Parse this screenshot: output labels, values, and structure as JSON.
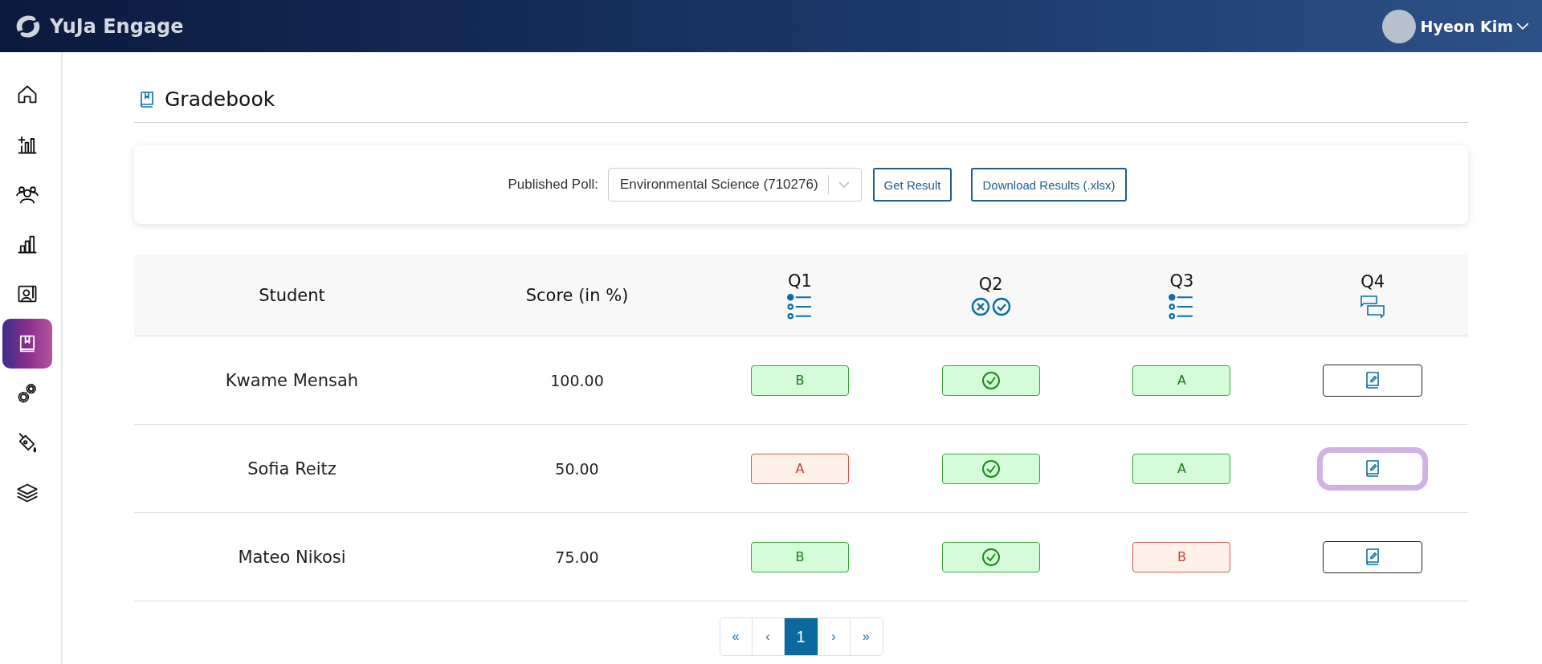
{
  "header": {
    "brand": "YuJa Engage",
    "user": "Hyeon Kim"
  },
  "sidebar": {
    "items": [
      {
        "kind": "home",
        "selected": false
      },
      {
        "kind": "create-chart",
        "selected": false
      },
      {
        "kind": "people",
        "selected": false
      },
      {
        "kind": "chart",
        "selected": false
      },
      {
        "kind": "presenter",
        "selected": false
      },
      {
        "kind": "gradebook",
        "selected": true
      },
      {
        "kind": "gears",
        "selected": false
      },
      {
        "kind": "paint",
        "selected": false
      },
      {
        "kind": "layers",
        "selected": false
      }
    ]
  },
  "page": {
    "title": "Gradebook"
  },
  "filter": {
    "label": "Published Poll:",
    "poll_value": "Environmental Science (710276)",
    "buttons": [
      "Get Result",
      "Download Results (.xlsx)"
    ]
  },
  "table": {
    "columns": [
      {
        "label": "Student"
      },
      {
        "label": "Score (in %)"
      },
      {
        "label": "Q1",
        "kind": "multiple-choice"
      },
      {
        "label": "Q2",
        "kind": "true-false"
      },
      {
        "label": "Q3",
        "kind": "multiple-choice"
      },
      {
        "label": "Q4",
        "kind": "open-ended"
      }
    ],
    "rows": [
      {
        "student": "Kwame Mensah",
        "score": "100.00",
        "answers": [
          {
            "kind": "choice",
            "text": "B",
            "correct": true
          },
          {
            "kind": "truefalse",
            "correct": true
          },
          {
            "kind": "choice",
            "text": "A",
            "correct": true
          },
          {
            "kind": "open",
            "focused": false
          }
        ]
      },
      {
        "student": "Sofia Reitz",
        "score": "50.00",
        "answers": [
          {
            "kind": "choice",
            "text": "A",
            "correct": false
          },
          {
            "kind": "truefalse",
            "correct": true
          },
          {
            "kind": "choice",
            "text": "A",
            "correct": true
          },
          {
            "kind": "open",
            "focused": true
          }
        ]
      },
      {
        "student": "Mateo Nikosi",
        "score": "75.00",
        "answers": [
          {
            "kind": "choice",
            "text": "B",
            "correct": true
          },
          {
            "kind": "truefalse",
            "correct": true
          },
          {
            "kind": "choice",
            "text": "B",
            "correct": false
          },
          {
            "kind": "open",
            "focused": false
          }
        ]
      }
    ]
  },
  "pagination": [
    {
      "label": "«",
      "selected": false
    },
    {
      "label": "‹",
      "selected": false
    },
    {
      "label": "1",
      "selected": true
    },
    {
      "label": "›",
      "selected": false
    },
    {
      "label": "»",
      "selected": false
    }
  ]
}
